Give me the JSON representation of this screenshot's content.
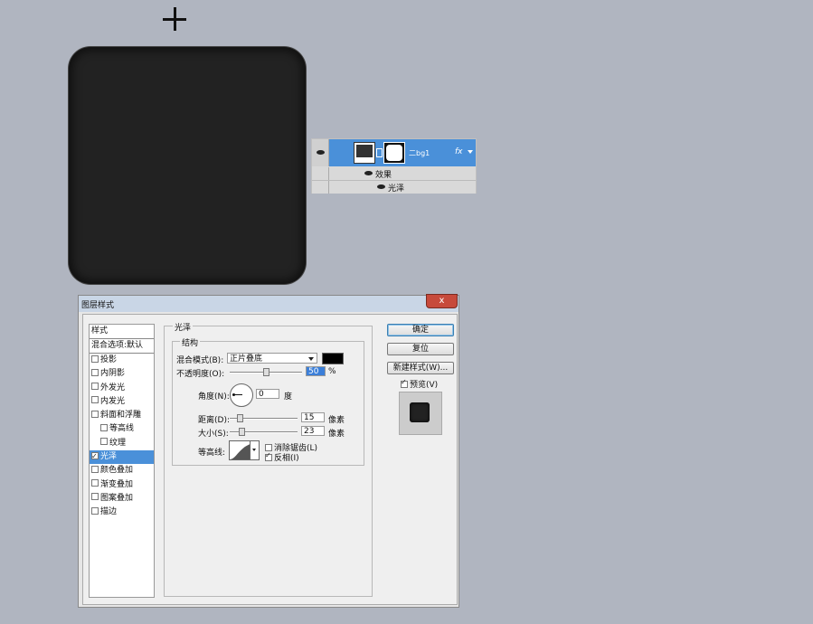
{
  "layers_panel": {
    "layer_name": "二bg1",
    "fx": "fx",
    "effects_label": "效果",
    "effect_item": "光泽"
  },
  "dialog": {
    "title": "图层样式",
    "close": "x",
    "styles_header": "样式",
    "blend_default": "混合选项:默认",
    "style_items": [
      {
        "label": "投影",
        "checked": false
      },
      {
        "label": "内阴影",
        "checked": false
      },
      {
        "label": "外发光",
        "checked": false
      },
      {
        "label": "内发光",
        "checked": false
      },
      {
        "label": "斜面和浮雕",
        "checked": false
      },
      {
        "label": "等高线",
        "checked": false
      },
      {
        "label": "纹理",
        "checked": false
      },
      {
        "label": "光泽",
        "checked": true
      },
      {
        "label": "颜色叠加",
        "checked": false
      },
      {
        "label": "渐变叠加",
        "checked": false
      },
      {
        "label": "图案叠加",
        "checked": false
      },
      {
        "label": "描边",
        "checked": false
      }
    ],
    "section_title": "光泽",
    "structure_title": "结构",
    "blend_mode_label": "混合模式(B):",
    "blend_mode_value": "正片叠底",
    "opacity_label": "不透明度(O):",
    "opacity_value": "50",
    "opacity_unit": "%",
    "angle_label": "角度(N):",
    "angle_value": "0",
    "angle_unit": "度",
    "distance_label": "距离(D):",
    "distance_value": "15",
    "distance_unit": "像素",
    "size_label": "大小(S):",
    "size_value": "23",
    "size_unit": "像素",
    "contour_label": "等高线:",
    "antialias_label": "消除锯齿(L)",
    "antialias_checked": false,
    "invert_label": "反相(I)",
    "invert_checked": true,
    "ok_button": "确定",
    "reset_button": "复位",
    "new_style_button": "新建样式(W)...",
    "preview_label": "预览(V)",
    "preview_checked": true
  },
  "colors": {
    "background": "#b0b5c0",
    "accent": "#4a90d9",
    "canvas_shape": "#222222"
  }
}
